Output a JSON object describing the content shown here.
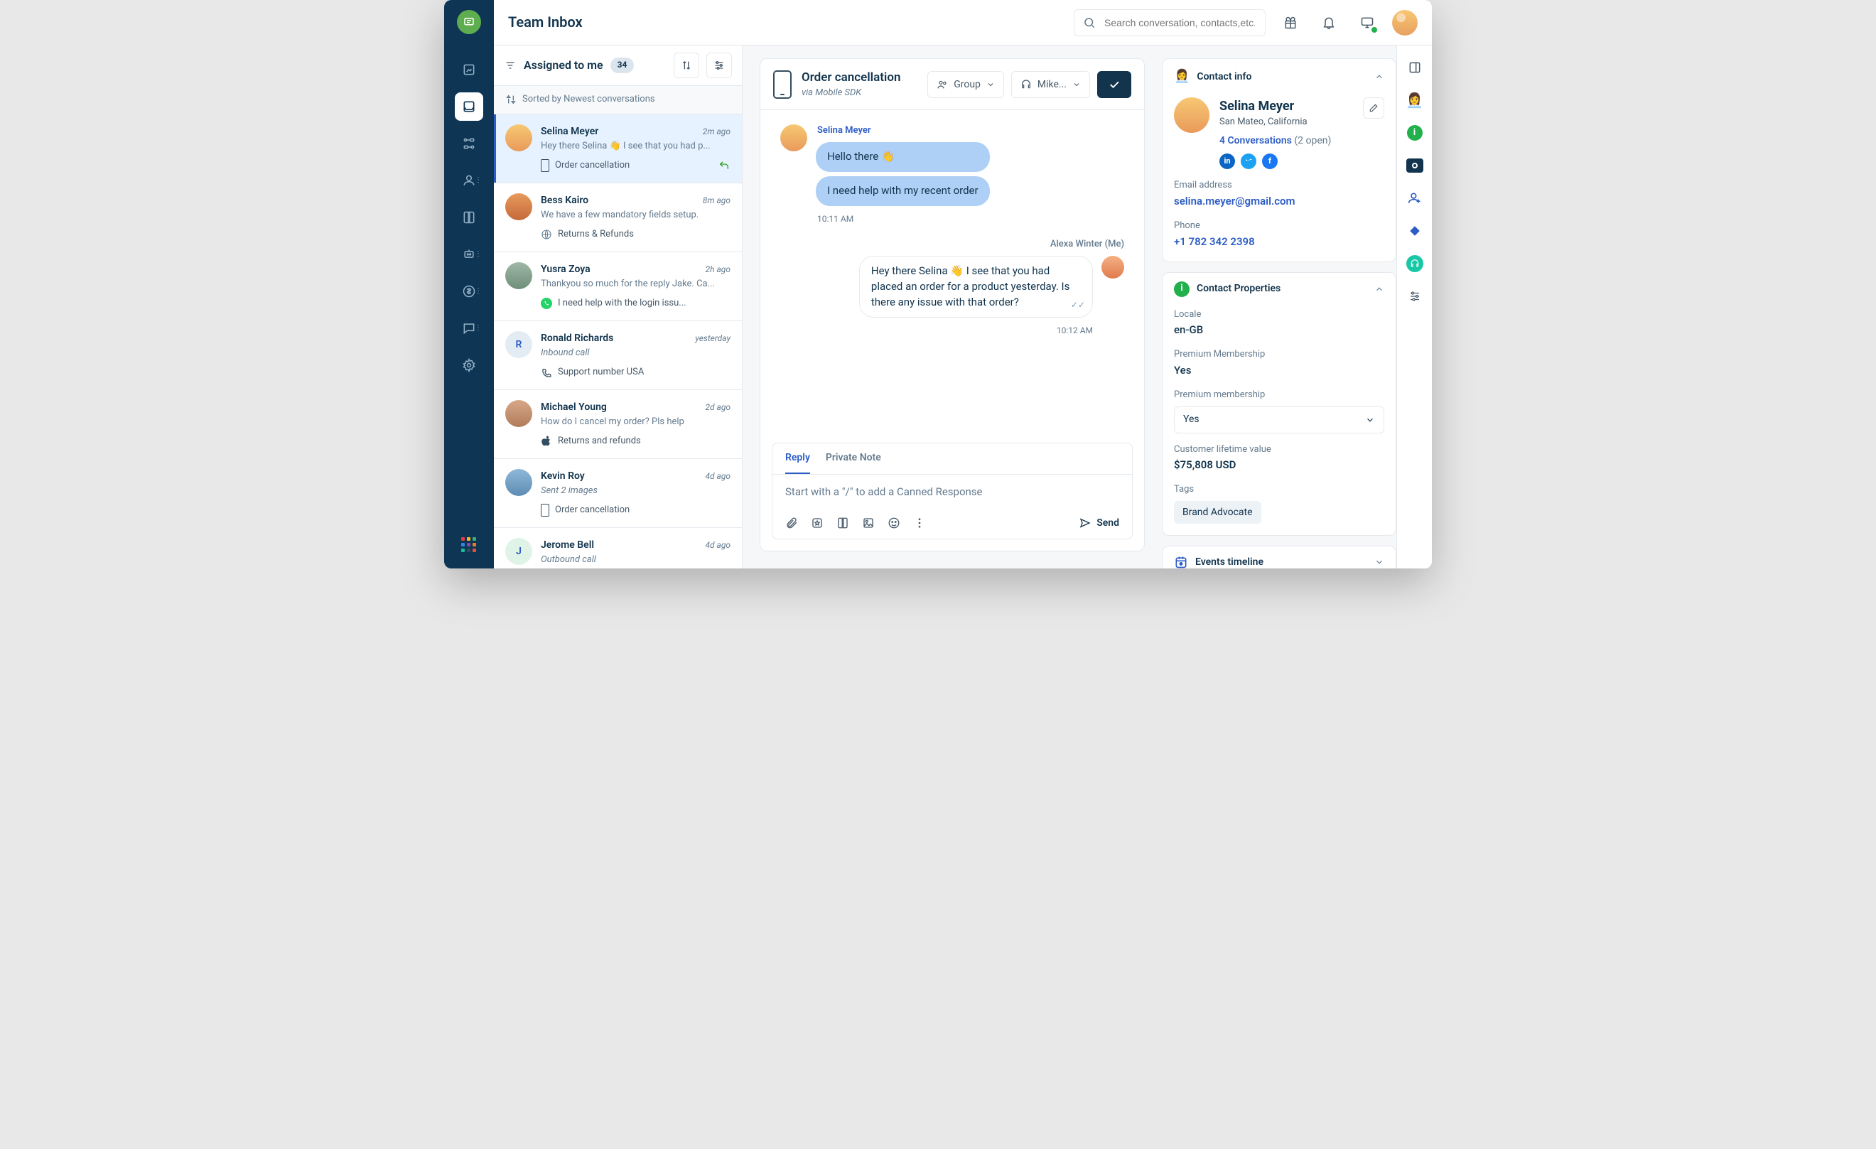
{
  "header": {
    "title": "Team Inbox",
    "search_placeholder": "Search conversation, contacts,etc."
  },
  "list": {
    "filter_label": "Assigned to me",
    "count": "34",
    "sort_label": "Sorted by Newest conversations"
  },
  "conversations": [
    {
      "name": "Selina Meyer",
      "time": "2m ago",
      "preview": "Hey there Selina 👋 I see that you had p...",
      "info": "Order cancellation",
      "channel": "mobile",
      "show_reply": true
    },
    {
      "name": "Bess Kairo",
      "time": "8m ago",
      "preview": "We have a few mandatory fields setup.",
      "info": "Returns & Refunds",
      "channel": "web"
    },
    {
      "name": "Yusra Zoya",
      "time": "2h ago",
      "preview": "Thankyou so much for the reply Jake. Ca...",
      "info": "I need help with the login issu...",
      "channel": "whatsapp"
    },
    {
      "name": "Ronald Richards",
      "time": "yesterday",
      "preview": "Inbound call",
      "preview_italic": true,
      "info": "Support number USA",
      "channel": "phone",
      "initial": "R"
    },
    {
      "name": "Michael Young",
      "time": "2d ago",
      "preview": "How do I cancel my order? Pls help",
      "info": "Returns and refunds",
      "channel": "apple"
    },
    {
      "name": "Kevin Roy",
      "time": "4d ago",
      "preview": "Sent 2 images",
      "preview_italic": true,
      "info": "Order cancellation",
      "channel": "mobile"
    },
    {
      "name": "Jerome Bell",
      "time": "4d ago",
      "preview": "Outbound call",
      "preview_italic": true,
      "info": "",
      "channel": "",
      "initial": "J"
    }
  ],
  "thread": {
    "title": "Order cancellation",
    "via": "via Mobile SDK",
    "group_label": "Group",
    "assignee_label": "Mike...",
    "sender_left": "Selina Meyer",
    "bubble1": "Hello there 👋",
    "bubble2": "I need help with my recent order",
    "ts_left": "10:11 AM",
    "sender_right": "Alexa Winter (Me)",
    "bubble3": "Hey there Selina 👋 I see that you had placed an order for a product yesterday. Is there any issue with that order?",
    "ts_right": "10:12 AM"
  },
  "composer": {
    "tab_reply": "Reply",
    "tab_note": "Private Note",
    "placeholder": "Start with a \"/\" to add a Canned Response",
    "send": "Send"
  },
  "contact": {
    "panel_title": "Contact info",
    "name": "Selina Meyer",
    "location": "San Mateo, California",
    "conversations_link": "4 Conversations",
    "conversations_sub": "(2 open)",
    "email_label": "Email address",
    "email": "selina.meyer@gmail.com",
    "phone_label": "Phone",
    "phone": "+1 782 342 2398",
    "properties_title": "Contact Properties",
    "locale_label": "Locale",
    "locale": "en-GB",
    "premium_label": "Premium Membership",
    "premium": "Yes",
    "premium_select_label": "Premium membership",
    "premium_select": "Yes",
    "clv_label": "Customer lifetime value",
    "clv": "$75,808 USD",
    "tags_label": "Tags",
    "tag": "Brand Advocate",
    "events_title": "Events timeline"
  }
}
